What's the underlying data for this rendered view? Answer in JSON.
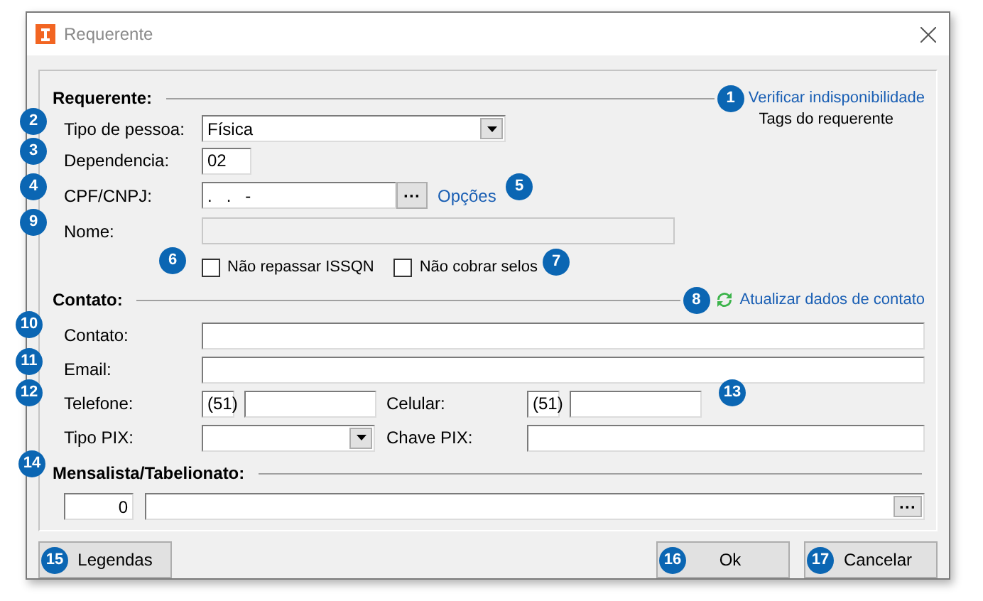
{
  "window": {
    "title": "Requerente"
  },
  "requerente": {
    "heading": "Requerente:",
    "link": "Verificar indisponibilidade",
    "tags_label": "Tags do requerente",
    "fields": [
      {
        "kind": "select",
        "label": "Tipo de pessoa:",
        "value": "Física"
      },
      {
        "kind": "short",
        "label": "Dependencia:",
        "value": "02"
      },
      {
        "kind": "lookup",
        "label": "CPF/CNPJ:",
        "value": ".   .   -",
        "button": "···",
        "link": "Opções"
      },
      {
        "kind": "disabled",
        "label": "Nome:"
      }
    ],
    "checkboxes": [
      {
        "label": "Não repassar ISSQN",
        "checked": false
      },
      {
        "label": "Não cobrar selos",
        "checked": false
      }
    ]
  },
  "contato": {
    "heading": "Contato:",
    "link": "Atualizar dados de contato",
    "fields": [
      {
        "label": "Contato:"
      },
      {
        "label": "Email:"
      }
    ],
    "phones": [
      {
        "label": "Telefone:",
        "area": "(51)"
      },
      {
        "label": "Celular:",
        "area": "(51)"
      }
    ],
    "pix": {
      "type_label": "Tipo PIX:",
      "key_label": "Chave PIX:"
    }
  },
  "mensalista": {
    "heading": "Mensalista/Tabelionato:",
    "code": "0",
    "button": "···"
  },
  "buttons": [
    {
      "label": "Legendas"
    },
    {
      "label": "Ok"
    },
    {
      "label": "Cancelar"
    }
  ],
  "badges": [
    "1",
    "2",
    "3",
    "4",
    "5",
    "6",
    "7",
    "8",
    "9",
    "10",
    "11",
    "12",
    "13",
    "14",
    "15",
    "16",
    "17"
  ]
}
